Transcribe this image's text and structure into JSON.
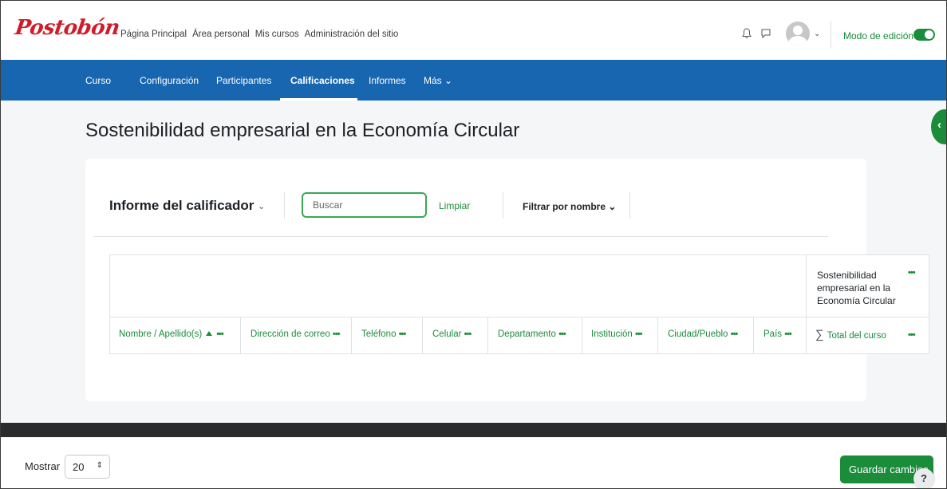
{
  "brand": {
    "logo_text": "Postobón",
    "logo_color": "#d11a2a"
  },
  "topnav": [
    "Página Principal",
    "Área personal",
    "Mis cursos",
    "Administración del sitio"
  ],
  "header": {
    "edit_mode_label": "Modo de edición",
    "edit_mode_on": true
  },
  "secnav": {
    "items": [
      "Curso",
      "Configuración",
      "Participantes",
      "Calificaciones",
      "Informes",
      "Más ⌄"
    ],
    "active": "Calificaciones"
  },
  "page": {
    "title": "Sostenibilidad empresarial en la Economía Circular"
  },
  "report": {
    "title": "Informe del calificador",
    "search_placeholder": "Buscar",
    "clear_label": "Limpiar",
    "filter_label": "Filtrar por nombre ⌄"
  },
  "table": {
    "category_title": "Sostenibilidad empresarial en la Economía Circular",
    "columns": [
      "Nombre / Apellido(s)",
      "Dirección de correo",
      "Teléfono",
      "Celular",
      "Departamento",
      "Institución",
      "Ciudad/Pueblo",
      "País",
      "Total del curso"
    ],
    "menu_glyph": "•••"
  },
  "footer": {
    "show_label": "Mostrar",
    "per_page": "20",
    "save_label": "Guardar cambios",
    "help_label": "?"
  },
  "colors": {
    "primary_green": "#1a8c3a",
    "nav_blue": "#1866b0"
  }
}
